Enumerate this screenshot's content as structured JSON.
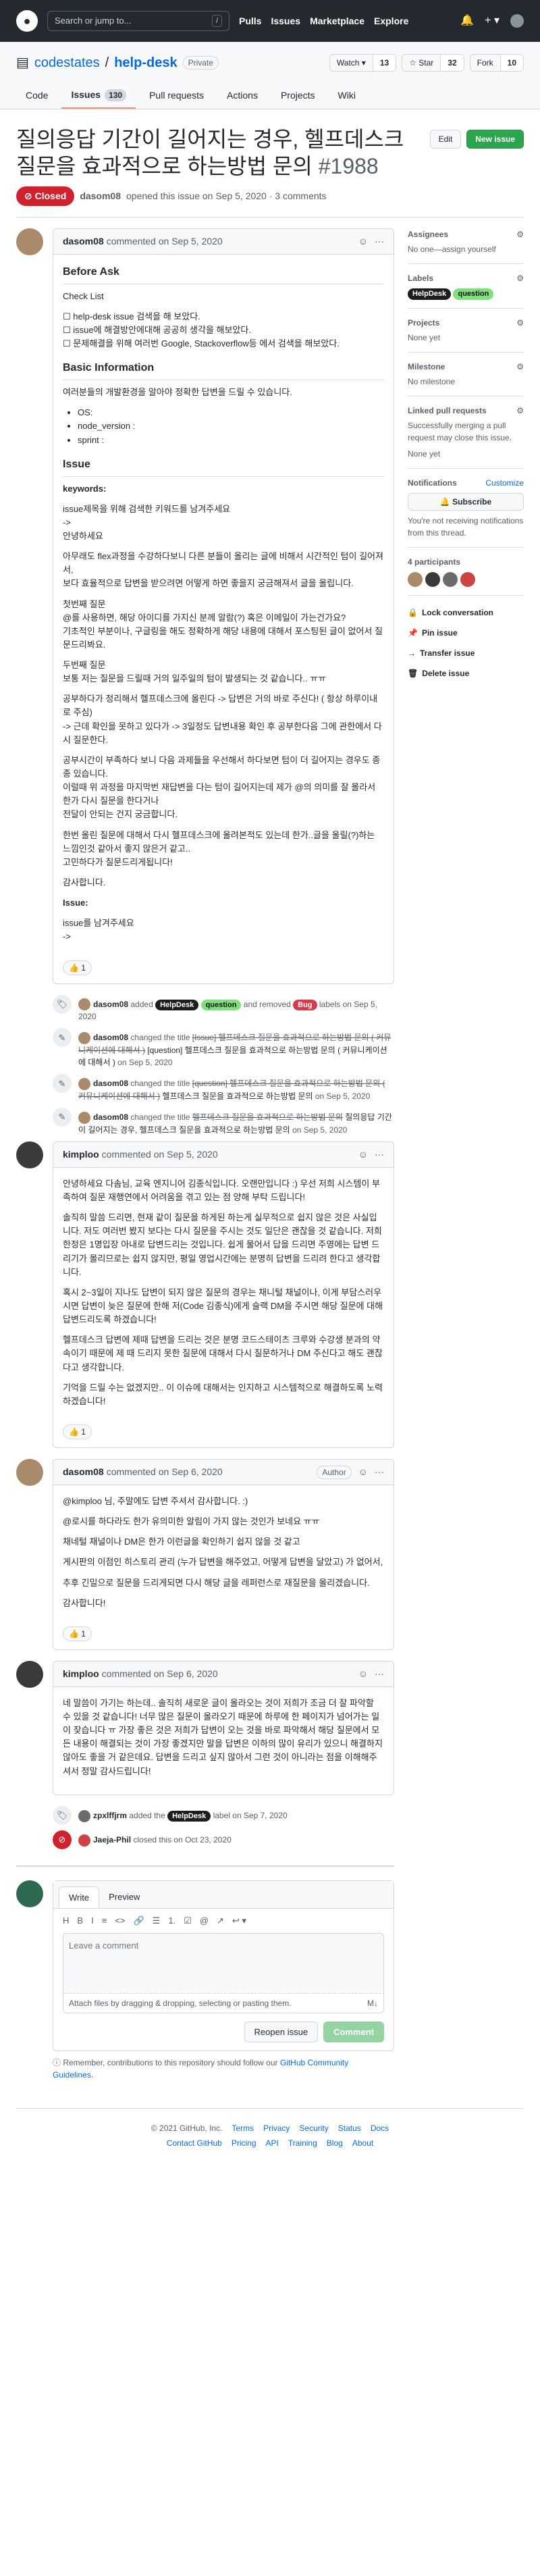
{
  "header": {
    "search_placeholder": "Search or jump to...",
    "search_key": "/",
    "nav": [
      "Pulls",
      "Issues",
      "Marketplace",
      "Explore"
    ],
    "plus": "+ ▾"
  },
  "repo": {
    "owner": "codestates",
    "name": "help-desk",
    "visibility": "Private",
    "watch_label": "Watch ▾",
    "watch_count": "13",
    "star_label": "☆ Star",
    "star_count": "32",
    "fork_label": "Fork",
    "fork_count": "10"
  },
  "tabs": [
    {
      "label": "Code"
    },
    {
      "label": "Issues",
      "count": "130"
    },
    {
      "label": "Pull requests"
    },
    {
      "label": "Actions"
    },
    {
      "label": "Projects"
    },
    {
      "label": "Wiki"
    }
  ],
  "issue": {
    "title": "질의응답 기간이 길어지는 경우, 헬프데스크 질문을 효과적으로 하는방법 문의",
    "number": "#1988",
    "edit": "Edit",
    "new_issue": "New issue",
    "state": "Closed",
    "author": "dasom08",
    "opened": "opened this issue on Sep 5, 2020 · 3 comments"
  },
  "first_comment": {
    "author": "dasom08",
    "when": "commented on Sep 5, 2020",
    "h_before_ask": "Before Ask",
    "check_list": "Check List",
    "checks": [
      "help-desk issue 검색을 해 보았다.",
      "issue에 해결방안에대해 공공히 생각을 해보았다.",
      "문제해결을 위해 여러번 Google, Stackoverflow등 에서 검색을 해보았다."
    ],
    "h_basic": "Basic Information",
    "basic_intro": "여러분들의 개발환경을 알아야 정확한 답변을 드릴 수 있습니다.",
    "basic_items": [
      "OS:",
      "node_version :",
      "sprint :"
    ],
    "h_issue": "Issue",
    "keywords": "keywords:",
    "paras": [
      "issue제목을 위해 검색한 키워드를 남겨주세요\n->\n안녕하세요",
      "아무래도 flex과정을 수강하다보니 다른 분들이 올리는 글에 비해서 시간적인 텀이 길어져서,\n보다 효율적으로 답변을 받으려면 어떻게 하면 좋을지 궁금해져서 글을 올립니다.",
      "첫번째 질문\n@를 사용하면, 해당 아이디를 가지신 분께 알람(?) 혹은 이메일이 가는건가요?\n기초적인 부분이나, 구글링을 해도 정확하게 해당 내용에 대해서 포스팅된 글이 없어서 질문드리봐요.",
      "두번째 질문\n보통 저는 질문을 드릴때 거의 일주일의 텀이 발생되는 것 같습니다.. ㅠㅠ",
      "공부하다가 정리해서 헬프데스크에 올린다 -> 답변은 거의 바로 주신다! ( 항상 하루이내로 주심)\n-> 근데 확인을 못하고 있다가 -> 3일정도 답변내용 확인 후 공부한다음 그에 관한에서 다시 질문한다.",
      "공부시간이 부족하다 보니 다음 과제들을 우선해서 하다보면 텀이 더 길어지는 경우도 종종 있습니다.\n이럴때 위 과정을 마지막번 재답변을 다는 텀이 길어지는데 제가 @의 의미를 잘 몰라서 한가 다시 질문을 한다거나\n전달이 안되는 건지 궁금합니다.",
      "한번 올린 질문에 대해서 다시 헬프데스크에 올려본적도 있는데 한가..글을 올릴(?)하는 느낌인것 같아서 좋지 않은거 같고..\n고민하다가 질문드리게됩니다!",
      "감사합니다."
    ],
    "issue_label": "Issue:",
    "issue_tail": "issue를 남겨주세요\n->",
    "reaction": "👍 1"
  },
  "events": [
    {
      "who": "dasom08",
      "text1": "added",
      "labels_added": [
        "HelpDesk",
        "question"
      ],
      "text2": "and removed",
      "labels_removed": [
        "Bug"
      ],
      "text3": "labels",
      "when": "on Sep 5, 2020"
    },
    {
      "who": "dasom08",
      "text1": "changed the title",
      "old": "[Issue] 헬프데스크 질문을 효과적으로 하는방법 문의 ( 커뮤니케이션에 대해서 )",
      "new": "[question] 헬프데스크 질문을 효과적으로 하는방법 문의 ( 커뮤니케이션에 대해서 )",
      "when": "on Sep 5, 2020"
    },
    {
      "who": "dasom08",
      "text1": "changed the title",
      "old": "[question] 헬프데스크 질문을 효과적으로 하는방법 문의 ( 커뮤니케이션에 대해서 )",
      "new": "헬프데스크 질문을 효과적으로 하는방법 문의",
      "when": "on Sep 5, 2020"
    },
    {
      "who": "dasom08",
      "text1": "changed the title",
      "old": "헬프데스크 질문을 효과적으로 하는방법 문의",
      "new": "질의응답 기간이 길어지는 경우, 헬프데스크 질문을 효과적으로 하는방법 문의",
      "when": "on Sep 5, 2020"
    }
  ],
  "kimploo1": {
    "author": "kimploo",
    "when": "commented on Sep 5, 2020",
    "paras": [
      "안녕하세요 다솜님, 교육 엔지니어 김종식입니다. 오랜만입니다 :) 우선 저희 시스템이 부족하여 질문 재행연에서 어려움을 겪고 있는 점 양해 부탁 드립니다!",
      "솔직히 말씀 드리면, 현재 같이 질문을 하게된 하는게 실무적으로 쉽지 않은 것은 사실입니다. 저도 여러번 봤지 보다는 다시 질문을 주시는 것도 일단은 괜찮을 것 같습니다. 저희 한정은 1명입장 아내로 답변드리는 것입니다. 쉽게 물어서 답을 드리면 주영에는 답변 드리기가 몰리므로는 쉽지 않지만, 평일 영업시간에는 분명히 답변을 드리려 한다고 생각합니다.",
      "혹시 2~3일이 지나도 답변이 되지 않은 질문의 경우는 채니털 채널이나, 이게 부담스러우시면 답변이 늦은 질문에 한해 저(Code 김종식)에게 슬랙 DM을 주시면 해당 질문에 대해 답변드리도록 하겠습니다!",
      "헬프데스크 답변에 제때 답변을 드리는 것은 분명 코드스테이츠 크루와 수강생 분과의 약속이기 때문에 제 때 드리지 못한 질문에 대해서 다시 질문하거나 DM 주신다고 해도 괜찮다고 생각합니다.",
      "기억을 드릴 수는 없겠지만.. 이 이슈에 대해서는 인지하고 시스템적으로 해결하도록 노력하겠습니다!"
    ],
    "reaction": "👍 1"
  },
  "dasom2": {
    "author": "dasom08",
    "when": "commented on Sep 6, 2020",
    "role": "Author",
    "paras": [
      "@kimploo 님, 주말에도 답변 주셔서 감사합니다. :)",
      "@로시를 하다라도 한가 유의미한 알림이 가지 않는 것인가 보네요 ㅠㅠ",
      "채네털 채널이나 DM은 한가 이런글을 확인하기 쉽지 않을 것 같고",
      "게시판의 이점인 히스토리 관리 (누가 답변을 해주었고, 어떻게 답변을 달았고) 가 없어서,",
      "추후 긴밀으로 질문을 드리게되면 다시 해당 글을 레퍼런스로 재질문을 올리겠습니다.",
      "감사합니다!"
    ],
    "reaction": "👍 1"
  },
  "kimploo2": {
    "author": "kimploo",
    "when": "commented on Sep 6, 2020",
    "paras": [
      "네 말씀이 가기는 하는데.. 솔직히 새로운 글이 올라오는 것이 저희가 조금 더 잘 파악할 수 있을 것 같습니다! 너무 많은 질문이 올라오기 때문에 하루에 한 페이지가 넘어가는 일이 잦습니다 ㅠ 가장 좋은 것은 저희가 답변이 오는 것을 바로 파악해서 해당 질문에서 모든 내용이 해결되는 것이 가장 좋겠지만 말을 답변은 이하의 많이 유리가 있으니 해결하지 않아도 좋을 거 같은데요. 답변을 드리고 싶지 않아서 그런 것이 아니라는 점을 이해해주셔서 정말 감사드립니다!"
    ]
  },
  "close_events": [
    {
      "who": "zpxlffjrm",
      "text": "added the",
      "label": "HelpDesk",
      "text2": "label on Sep 7, 2020"
    },
    {
      "who": "Jaeja-Phil",
      "text": "closed this on Oct 23, 2020"
    }
  ],
  "new_comment": {
    "tab_write": "Write",
    "tab_preview": "Preview",
    "tools": [
      "H",
      "B",
      "I",
      "≡",
      "<>",
      "🔗",
      "☰",
      "1.",
      "☑",
      "@",
      "↗",
      "↩ ▾"
    ],
    "placeholder": "Leave a comment",
    "attach": "Attach files by dragging & dropping, selecting or pasting them.",
    "md": "M↓",
    "reopen": "Reopen issue",
    "comment": "Comment",
    "remind": "Remember, contributions to this repository should follow our",
    "remind_link": "GitHub Community Guidelines."
  },
  "sidebar": {
    "assignees_h": "Assignees",
    "assignees_v": "No one—assign yourself",
    "labels_h": "Labels",
    "labels": [
      "HelpDesk",
      "question"
    ],
    "projects_h": "Projects",
    "projects_v": "None yet",
    "milestone_h": "Milestone",
    "milestone_v": "No milestone",
    "linked_h": "Linked pull requests",
    "linked_v": "Successfully merging a pull request may close this issue.",
    "linked_v2": "None yet",
    "notif_h": "Notifications",
    "notif_customize": "Customize",
    "subscribe": "🔔 Subscribe",
    "notif_v": "You're not receiving notifications from this thread.",
    "participants": "4 participants",
    "actions": [
      "Lock conversation",
      "Pin issue",
      "Transfer issue",
      "Delete issue"
    ]
  },
  "footer": {
    "copy": "© 2021 GitHub, Inc.",
    "links1": [
      "Terms",
      "Privacy",
      "Security",
      "Status",
      "Docs"
    ],
    "links2": [
      "Contact GitHub",
      "Pricing",
      "API",
      "Training",
      "Blog",
      "About"
    ]
  },
  "colors": {
    "label_helpdesk": "#1d1d1d",
    "label_question": "#7ee17e",
    "label_bug": "#d73a4a",
    "closed": "#cf222e"
  }
}
